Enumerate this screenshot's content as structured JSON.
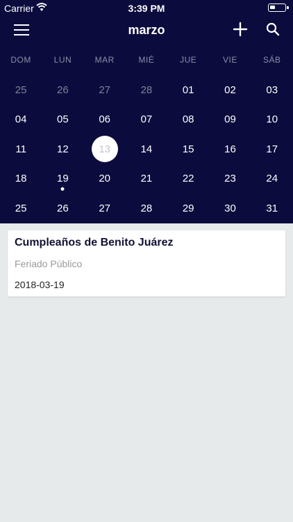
{
  "status_bar": {
    "carrier": "Carrier",
    "time": "3:39 PM",
    "battery_level": 0.35
  },
  "header": {
    "title": "marzo"
  },
  "colors": {
    "header_bg": "#0b0b3d",
    "content_bg": "#e6eaea"
  },
  "weekdays": [
    "DOM",
    "LUN",
    "MAR",
    "MIÉ",
    "JUE",
    "VIE",
    "SÁB"
  ],
  "weeks": [
    [
      {
        "label": "25",
        "muted": true
      },
      {
        "label": "26",
        "muted": true
      },
      {
        "label": "27",
        "muted": true
      },
      {
        "label": "28",
        "muted": true
      },
      {
        "label": "01"
      },
      {
        "label": "02"
      },
      {
        "label": "03"
      }
    ],
    [
      {
        "label": "04"
      },
      {
        "label": "05"
      },
      {
        "label": "06"
      },
      {
        "label": "07"
      },
      {
        "label": "08"
      },
      {
        "label": "09"
      },
      {
        "label": "10"
      }
    ],
    [
      {
        "label": "11"
      },
      {
        "label": "12"
      },
      {
        "label": "13",
        "selected": true
      },
      {
        "label": "14"
      },
      {
        "label": "15"
      },
      {
        "label": "16"
      },
      {
        "label": "17"
      }
    ],
    [
      {
        "label": "18"
      },
      {
        "label": "19",
        "event": true
      },
      {
        "label": "20"
      },
      {
        "label": "21"
      },
      {
        "label": "22"
      },
      {
        "label": "23"
      },
      {
        "label": "24"
      }
    ],
    [
      {
        "label": "25"
      },
      {
        "label": "26"
      },
      {
        "label": "27"
      },
      {
        "label": "28"
      },
      {
        "label": "29"
      },
      {
        "label": "30"
      },
      {
        "label": "31"
      }
    ]
  ],
  "events": [
    {
      "title": "Cumpleaños de Benito Juárez",
      "type": "Feriado Público",
      "date": "2018-03-19"
    }
  ]
}
